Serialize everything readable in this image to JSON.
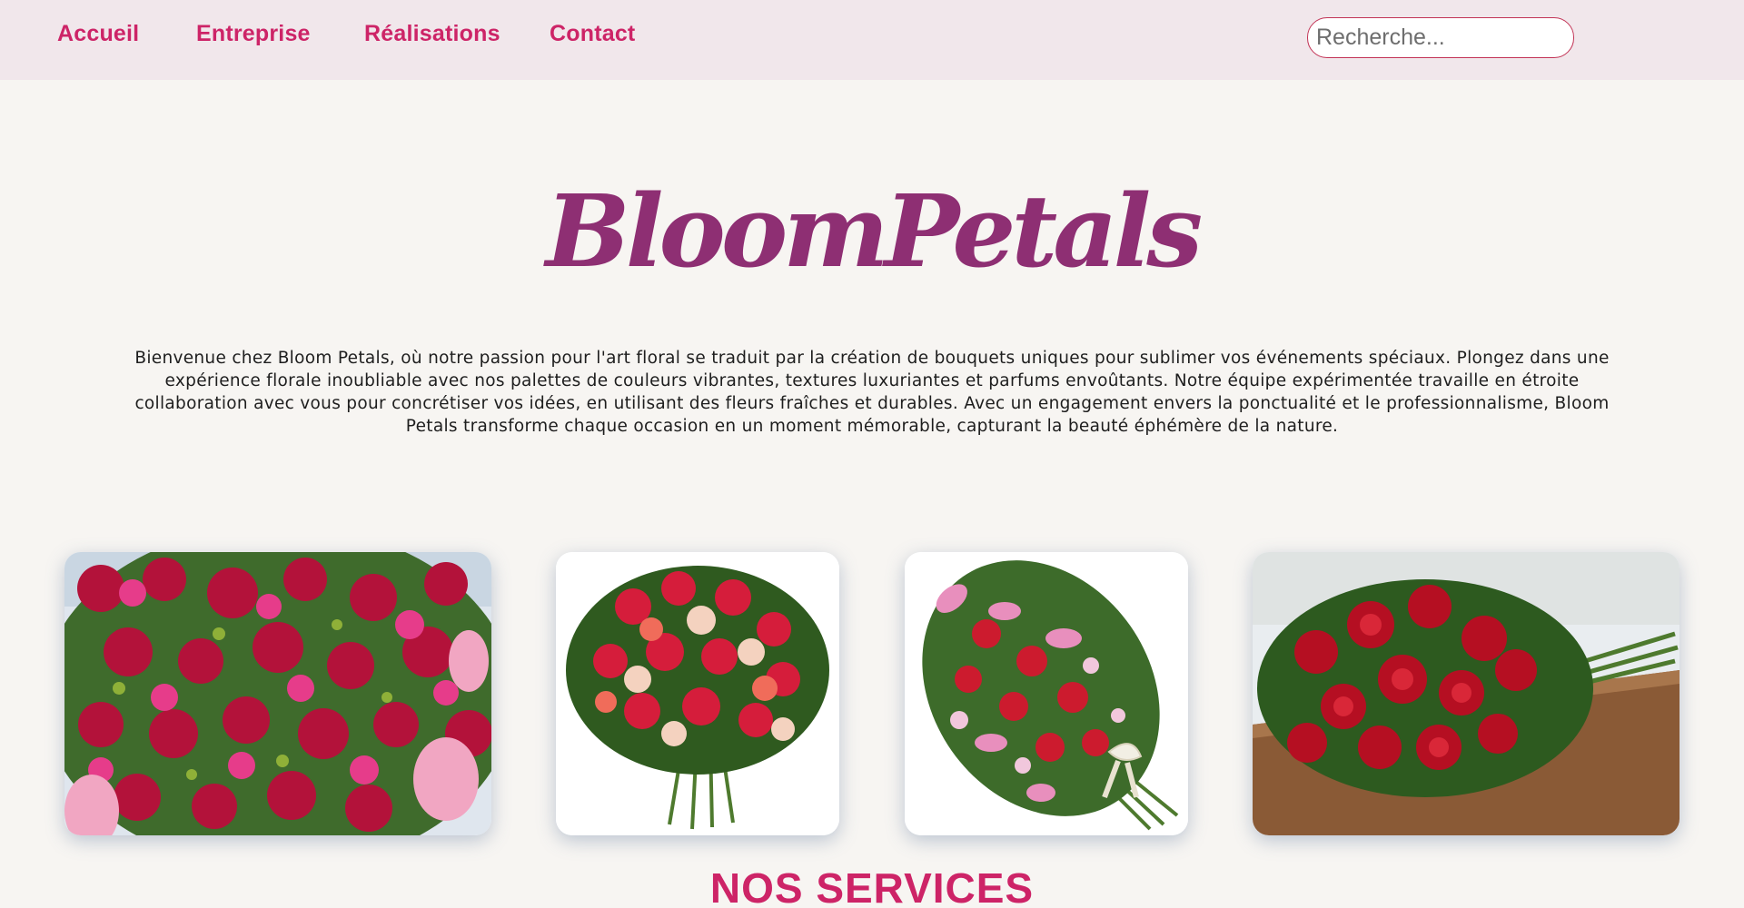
{
  "nav": {
    "items": [
      {
        "label": "Accueil"
      },
      {
        "label": "Entreprise"
      },
      {
        "label": "Réalisations"
      },
      {
        "label": "Contact"
      }
    ]
  },
  "search": {
    "placeholder": "Recherche..."
  },
  "hero": {
    "brand": "BloomPetals",
    "intro": "Bienvenue chez Bloom Petals, où notre passion pour l'art floral se traduit par la création de bouquets uniques pour sublimer vos événements spéciaux. Plongez dans une expérience florale inoubliable avec nos palettes de couleurs vibrantes, textures luxuriantes et parfums envoûtants. Notre équipe expérimentée travaille en étroite collaboration avec vous pour concrétiser vos idées, en utilisant des fleurs fraîches et durables. Avec un engagement envers la ponctualité et le professionnalisme, Bloom Petals transforme chaque occasion en un moment mémorable, capturant la beauté éphémère de la nature."
  },
  "gallery": {
    "images": [
      {
        "name": "bouquet-pink-red-roses-proteas"
      },
      {
        "name": "bouquet-mixed-roses-white-bg"
      },
      {
        "name": "bouquet-lilies-roses-ribbon"
      },
      {
        "name": "bouquet-red-roses-on-table"
      }
    ]
  },
  "services": {
    "title": "NOS SERVICES"
  },
  "colors": {
    "accent": "#cd2467",
    "brand": "#8e2f73",
    "topbar": "#f1e7eb",
    "background": "#f7f5f2"
  }
}
